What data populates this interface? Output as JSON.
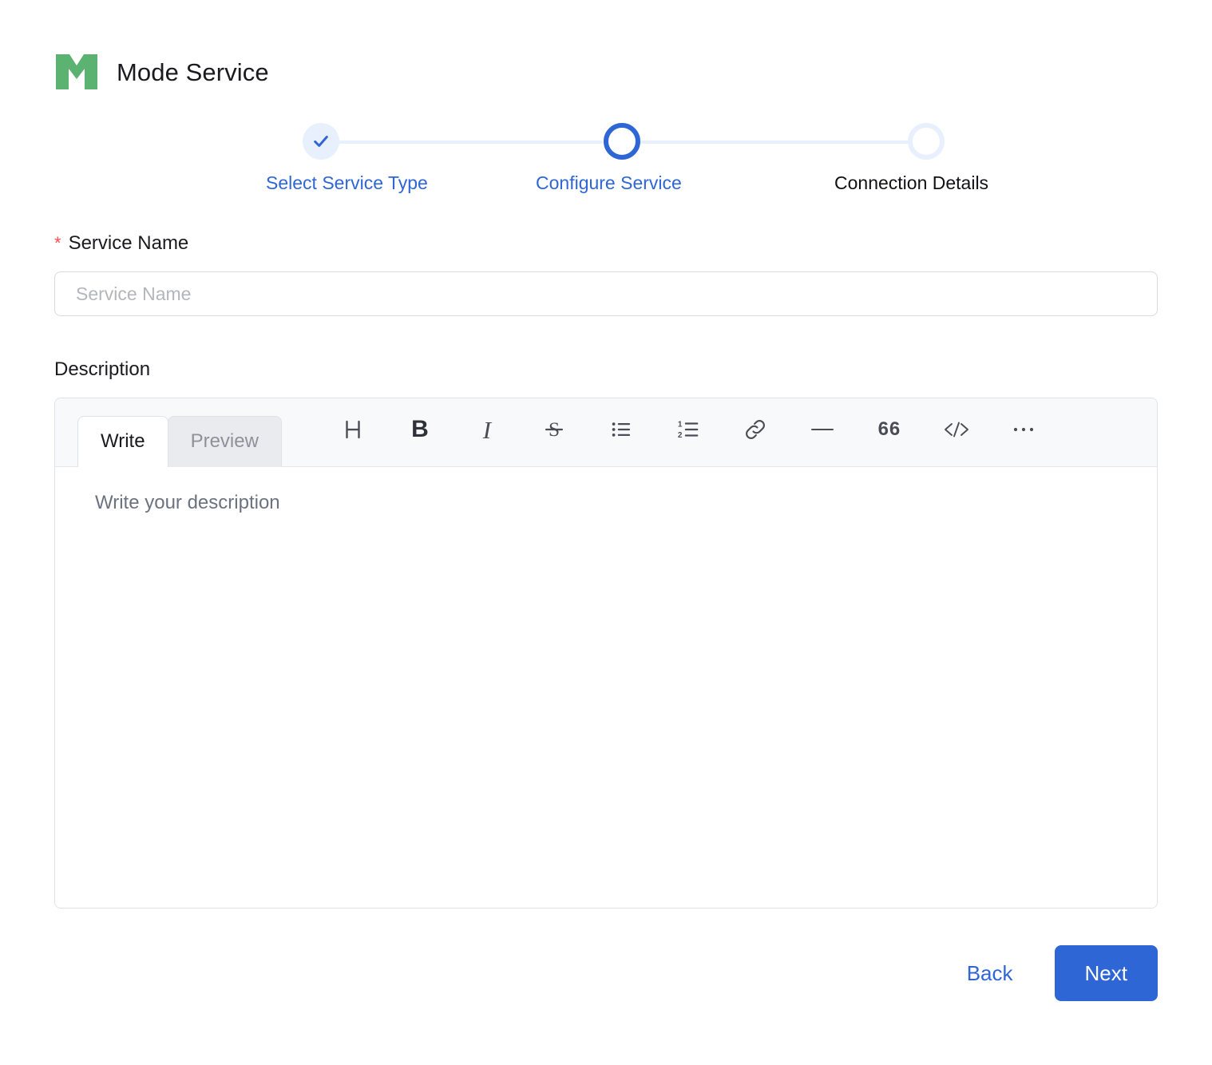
{
  "header": {
    "title": "Mode Service",
    "logo_icon": "mode-logo-icon",
    "logo_color": "#5cb270"
  },
  "stepper": {
    "accent_color": "#2f66d5",
    "track_color": "#e8f0fe",
    "steps": [
      {
        "label": "Select Service Type",
        "state": "done",
        "icon": "check-icon"
      },
      {
        "label": "Configure Service",
        "state": "current",
        "icon": "circle-icon"
      },
      {
        "label": "Connection Details",
        "state": "todo",
        "icon": "circle-icon"
      }
    ]
  },
  "form": {
    "service_name": {
      "label": "Service Name",
      "required_marker": "*",
      "placeholder": "Service Name",
      "value": ""
    },
    "description": {
      "label": "Description",
      "editor": {
        "tabs": [
          {
            "label": "Write",
            "active": true
          },
          {
            "label": "Preview",
            "active": false
          }
        ],
        "tools": [
          {
            "name": "heading-icon",
            "title": "Heading"
          },
          {
            "name": "bold-icon",
            "title": "Bold"
          },
          {
            "name": "italic-icon",
            "title": "Italic"
          },
          {
            "name": "strikethrough-icon",
            "title": "Strikethrough"
          },
          {
            "name": "bullet-list-icon",
            "title": "Bulleted list"
          },
          {
            "name": "numbered-list-icon",
            "title": "Numbered list"
          },
          {
            "name": "link-icon",
            "title": "Link"
          },
          {
            "name": "horizontal-rule-icon",
            "title": "Horizontal rule"
          },
          {
            "name": "quote-icon",
            "title": "Quote"
          },
          {
            "name": "code-icon",
            "title": "Code"
          },
          {
            "name": "more-options-icon",
            "title": "More"
          }
        ],
        "placeholder": "Write your description",
        "value": ""
      }
    }
  },
  "footer": {
    "back_label": "Back",
    "next_label": "Next",
    "primary_color": "#2f66d5"
  }
}
